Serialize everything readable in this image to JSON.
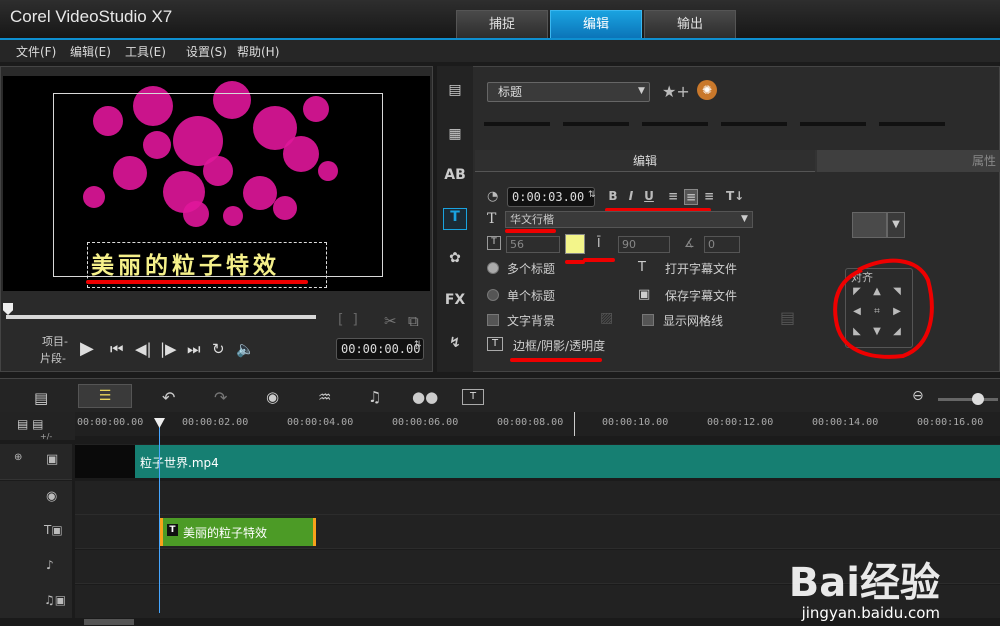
{
  "app": {
    "title": "Corel VideoStudio X7"
  },
  "top_tabs": [
    {
      "label": "捕捉"
    },
    {
      "label": "编辑"
    },
    {
      "label": "输出"
    }
  ],
  "menu": [
    {
      "label": "文件(F)"
    },
    {
      "label": "编辑(E)"
    },
    {
      "label": "工具(E)"
    },
    {
      "label": "设置(S)"
    },
    {
      "label": "帮助(H)"
    }
  ],
  "preview": {
    "title_text": "美丽的粒子特效",
    "mode_project": "项目-",
    "mode_clip": "片段-",
    "timecode": "00:00:00.00"
  },
  "title_options": {
    "category_select": "标题",
    "tab_edit": "编辑",
    "tab_properties": "属性",
    "duration": "0:00:03.00",
    "font": "华文行楷",
    "font_size": "56",
    "line_spacing": "90",
    "angle": "0",
    "multi_title": "多个标题",
    "single_title": "单个标题",
    "text_background": "文字背景",
    "open_subtitle": "打开字幕文件",
    "save_subtitle": "保存字幕文件",
    "show_grid": "显示网格线",
    "border_shadow": "边框/阴影/透明度",
    "align_label": "对齐",
    "accent": "#1aa3e0",
    "text_color": "#f3f58a"
  },
  "timeline": {
    "ruler": [
      "00:00:00.00",
      "00:00:02.00",
      "00:00:04.00",
      "00:00:06.00",
      "00:00:08.00",
      "00:00:10.00",
      "00:00:12.00",
      "00:00:14.00",
      "00:00:16.00"
    ],
    "video_clip": "粒子世界.mp4",
    "title_clip": "美丽的粒子特效",
    "title_clip_icon": "T"
  },
  "watermark": {
    "brand": "Bai经验",
    "url": "jingyan.baidu.com"
  }
}
